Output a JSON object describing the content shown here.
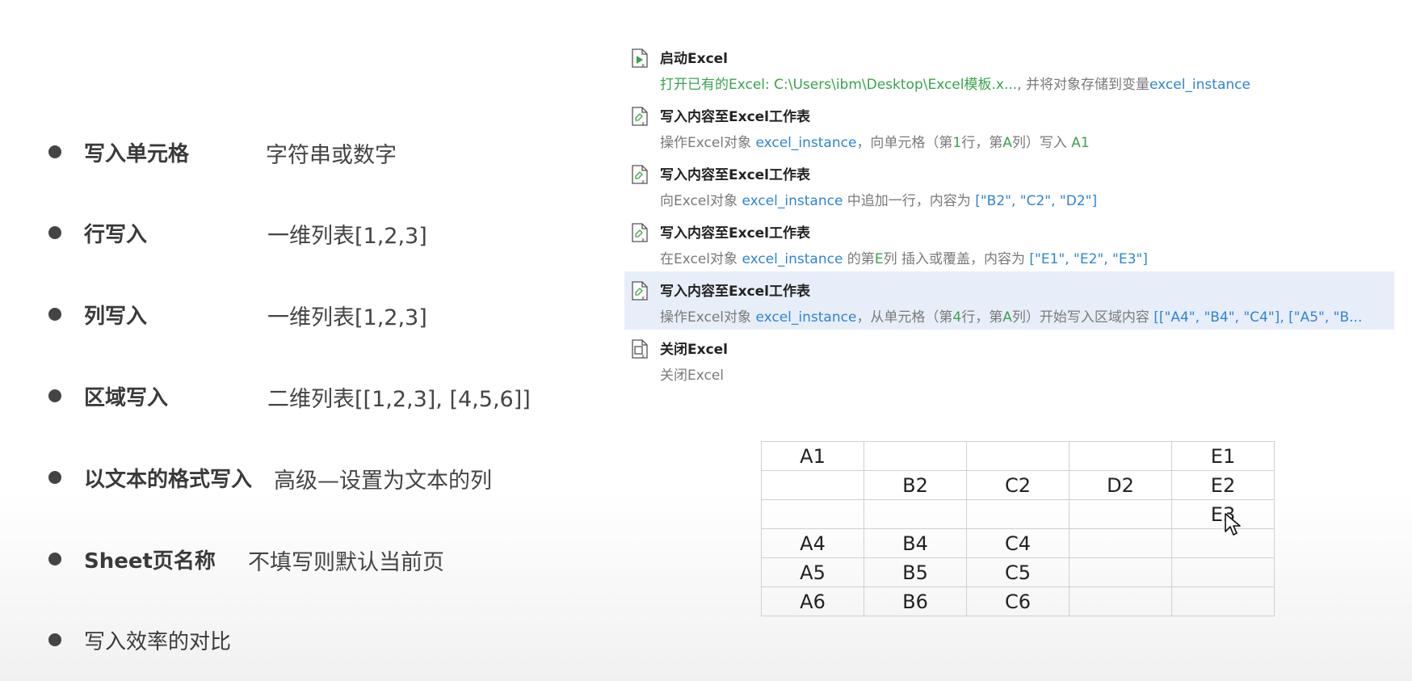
{
  "bullets": [
    {
      "label": "写入单元格",
      "value": "字符串或数字"
    },
    {
      "label": "行写入",
      "value": "一维列表[1,2,3]"
    },
    {
      "label": "列写入",
      "value": "一维列表[1,2,3]"
    },
    {
      "label": "区域写入",
      "value": "二维列表[[1,2,3], [4,5,6]]"
    },
    {
      "label": "以文本的格式写入",
      "value": "高级—设置为文本的列"
    },
    {
      "label": "Sheet页名称",
      "value": "不填写则默认当前页"
    },
    {
      "label": "写入效率的对比",
      "value": ""
    }
  ],
  "steps": [
    {
      "title": "启动Excel",
      "icon": "excel-launch-icon",
      "desc": [
        {
          "text": "打开已有的Excel: C:\\Users\\ibm\\Desktop\\Excel模板.x...",
          "color": "green"
        },
        {
          "text": ", 并将对象存储到变量",
          "color": "gray"
        },
        {
          "text": "excel_instance",
          "color": "blue"
        }
      ]
    },
    {
      "title": "写入内容至Excel工作表",
      "icon": "excel-write-icon",
      "desc": [
        {
          "text": "操作Excel对象 ",
          "color": "gray"
        },
        {
          "text": "excel_instance",
          "color": "blue"
        },
        {
          "text": "，向单元格（第",
          "color": "gray"
        },
        {
          "text": "1",
          "color": "green"
        },
        {
          "text": "行，第",
          "color": "gray"
        },
        {
          "text": "A",
          "color": "green"
        },
        {
          "text": "列）写入 ",
          "color": "gray"
        },
        {
          "text": "A1",
          "color": "green"
        }
      ]
    },
    {
      "title": "写入内容至Excel工作表",
      "icon": "excel-write-icon",
      "desc": [
        {
          "text": "向Excel对象 ",
          "color": "gray"
        },
        {
          "text": "excel_instance",
          "color": "blue"
        },
        {
          "text": " 中追加一行，内容为 ",
          "color": "gray"
        },
        {
          "text": "[\"B2\", \"C2\", \"D2\"]",
          "color": "blue"
        }
      ]
    },
    {
      "title": "写入内容至Excel工作表",
      "icon": "excel-write-icon",
      "desc": [
        {
          "text": "在Excel对象 ",
          "color": "gray"
        },
        {
          "text": "excel_instance",
          "color": "blue"
        },
        {
          "text": " 的第",
          "color": "gray"
        },
        {
          "text": "E",
          "color": "green"
        },
        {
          "text": "列 插入或覆盖，内容为 ",
          "color": "gray"
        },
        {
          "text": "[\"E1\", \"E2\", \"E3\"]",
          "color": "blue"
        }
      ]
    },
    {
      "title": "写入内容至Excel工作表",
      "icon": "excel-write-icon",
      "selected": true,
      "desc": [
        {
          "text": "操作Excel对象 ",
          "color": "gray"
        },
        {
          "text": "excel_instance",
          "color": "blue"
        },
        {
          "text": "，从单元格（第",
          "color": "gray"
        },
        {
          "text": "4",
          "color": "green"
        },
        {
          "text": "行，第",
          "color": "gray"
        },
        {
          "text": "A",
          "color": "green"
        },
        {
          "text": "列）开始写入区域内容 ",
          "color": "gray"
        },
        {
          "text": "[[\"A4\", \"B4\", \"C4\"], [\"A5\", \"B...",
          "color": "blue"
        }
      ]
    },
    {
      "title": "关闭Excel",
      "icon": "excel-close-icon",
      "desc": [
        {
          "text": "关闭Excel",
          "color": "gray"
        }
      ]
    }
  ],
  "grid": [
    [
      "A1",
      "",
      "",
      "",
      "E1"
    ],
    [
      "",
      "B2",
      "C2",
      "D2",
      "E2"
    ],
    [
      "",
      "",
      "",
      "",
      "E3"
    ],
    [
      "A4",
      "B4",
      "C4",
      "",
      ""
    ],
    [
      "A5",
      "B5",
      "C5",
      "",
      ""
    ],
    [
      "A6",
      "B6",
      "C6",
      "",
      ""
    ]
  ],
  "colors": {
    "green": "#3aa34d",
    "blue": "#2f84d6",
    "gray": "#7a7a7a",
    "selected_bg": "#e8eef9"
  }
}
